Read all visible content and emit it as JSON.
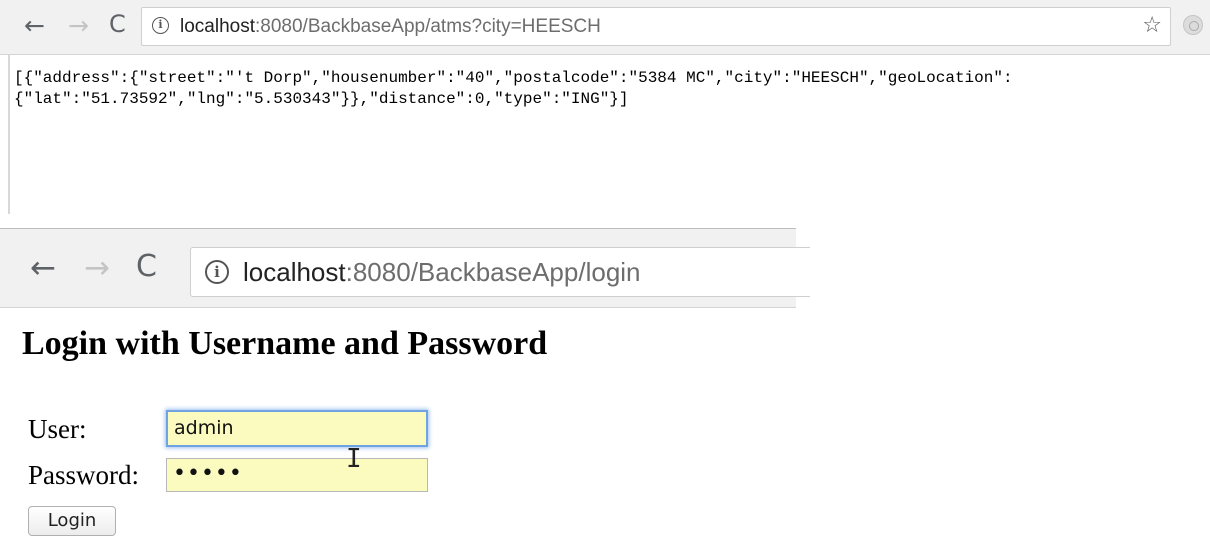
{
  "window1": {
    "url_host": "localhost",
    "url_rest": ":8080/BackbaseApp/atms?city=HEESCH",
    "json_line1": "[{\"address\":{\"street\":\"'t Dorp\",\"housenumber\":\"40\",\"postalcode\":\"5384 MC\",\"city\":\"HEESCH\",\"geoLocation\":",
    "json_line2": "{\"lat\":\"51.73592\",\"lng\":\"5.530343\"}},\"distance\":0,\"type\":\"ING\"}]"
  },
  "window2": {
    "url_host": "localhost",
    "url_rest": ":8080/BackbaseApp/login",
    "page_title": "Login with Username and Password",
    "form": {
      "user_label": "User:",
      "user_value": "admin",
      "password_label": "Password:",
      "password_value": "•••••",
      "login_button": "Login"
    }
  },
  "icons": [
    "back-arrow-icon",
    "forward-arrow-icon",
    "reload-icon",
    "info-icon",
    "bookmark-star-icon",
    "extension-icon",
    "text-cursor-icon"
  ],
  "colors": {
    "input_autofill_bg": "#fbfbc0",
    "focus_ring": "#6fa3e2",
    "toolbar_bg": "#f1f1f1"
  }
}
